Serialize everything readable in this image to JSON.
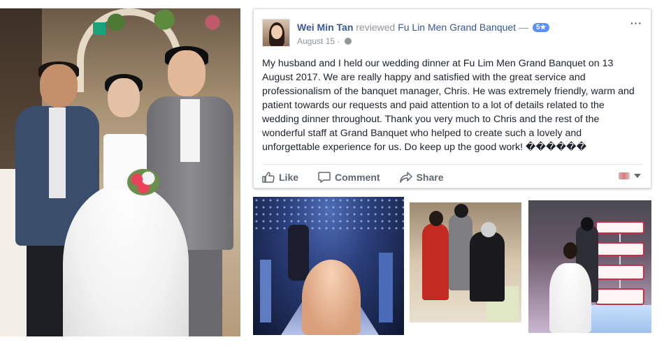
{
  "review": {
    "author_name": "Wei Min Tan",
    "action_text": "reviewed",
    "page_name": "Fu Lin Men Grand Banquet",
    "separator": "—",
    "rating_badge": "5★",
    "date": "August 15",
    "dot": "·",
    "more_menu": "···",
    "body": "My husband and I held our wedding dinner at Fu Lim Men Grand Banquet on 13 August 2017. We are really happy and satisfied with the great service and professionalism of the banquet manager, Chris. He was extremely friendly, warm and patient towards our requests and paid attention to a lot of details related to the wedding dinner throughout. Thank you very much to Chris and the rest of the wonderful staff at Grand Banquet who helped to create such a lovely and unforgettable experience for us. Do keep up the good work! ������",
    "actions": {
      "like": "Like",
      "comment": "Comment",
      "share": "Share"
    }
  },
  "colors": {
    "link_blue": "#365899",
    "rating_blue": "#5890ff",
    "meta_gray": "#90949c",
    "action_gray": "#616770"
  },
  "icons": {
    "like": "thumbs-up-icon",
    "comment": "speech-bubble-icon",
    "share": "share-arrow-icon",
    "audience": "globe-icon",
    "menu": "more-dots-icon",
    "dropdown": "caret-down-icon"
  }
}
